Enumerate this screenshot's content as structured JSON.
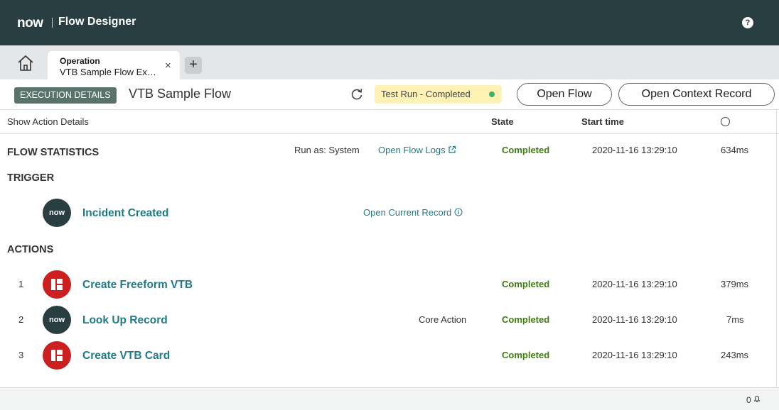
{
  "header": {
    "logo_text": "now",
    "app_title": "Flow Designer",
    "help_icon": "?"
  },
  "tabs": {
    "home_icon": "home-icon",
    "active_tab": {
      "label": "Operation",
      "name": "VTB Sample Flow Ex…",
      "close": "×"
    },
    "add_tab": "+"
  },
  "toolbar": {
    "badge": "EXECUTION DETAILS",
    "flow_name": "VTB Sample Flow",
    "status": "Test Run - Completed",
    "status_color": "#3fb26d",
    "open_flow": "Open Flow",
    "open_context": "Open Context Record"
  },
  "columns": {
    "show_action_details": "Show Action Details",
    "state": "State",
    "start_time": "Start time"
  },
  "flow_statistics": {
    "title": "FLOW STATISTICS",
    "run_as": "Run as: System",
    "open_logs": "Open Flow Logs",
    "state": "Completed",
    "start": "2020-11-16 13:29:10",
    "duration": "634ms"
  },
  "trigger": {
    "title": "TRIGGER",
    "name": "Incident Created",
    "icon_text": "now",
    "open_record": "Open Current Record"
  },
  "actions": {
    "title": "ACTIONS",
    "items": [
      {
        "num": "1",
        "name": "Create Freeform VTB",
        "note": "",
        "state": "Completed",
        "start": "2020-11-16 13:29:10",
        "duration": "379ms"
      },
      {
        "num": "2",
        "name": "Look Up Record",
        "note": "Core Action",
        "icon_text": "now",
        "state": "Completed",
        "start": "2020-11-16 13:29:10",
        "duration": "7ms"
      },
      {
        "num": "3",
        "name": "Create VTB Card",
        "note": "",
        "state": "Completed",
        "start": "2020-11-16 13:29:10",
        "duration": "243ms"
      }
    ]
  },
  "footer": {
    "count": "0"
  }
}
